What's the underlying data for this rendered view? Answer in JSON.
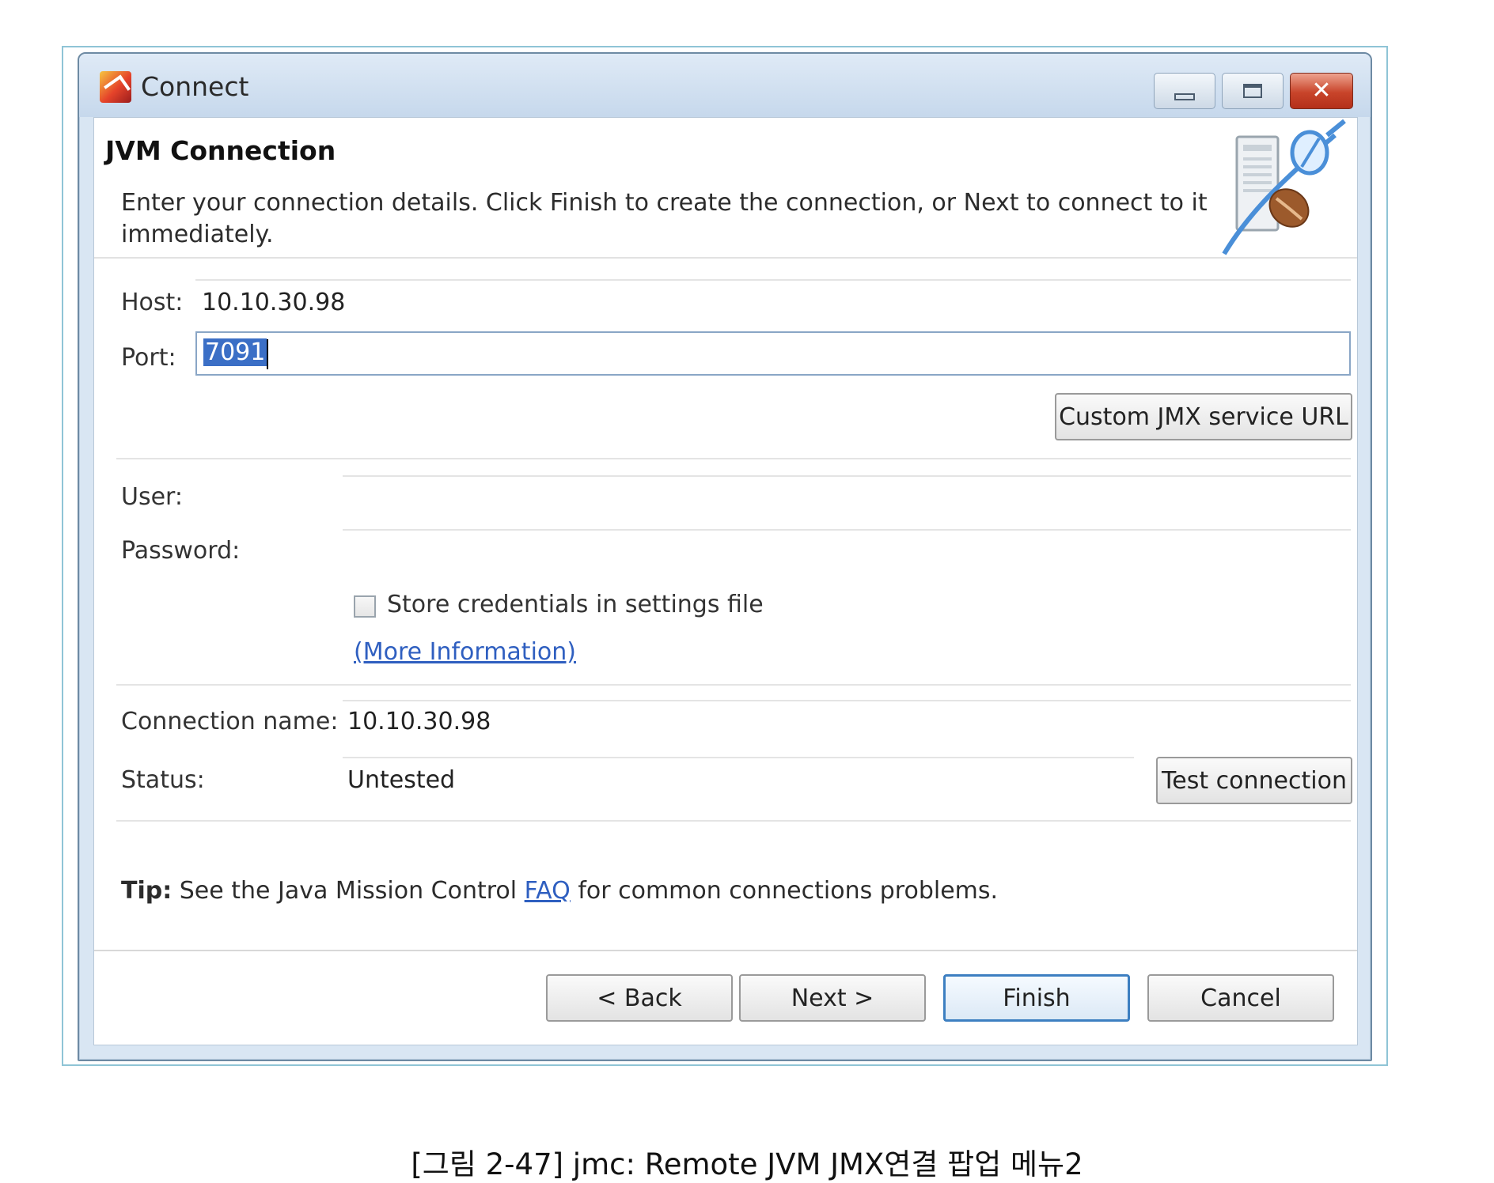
{
  "window": {
    "title": "Connect"
  },
  "header": {
    "title": "JVM Connection",
    "description": "Enter your connection details. Click Finish to create the connection, or Next to connect to it immediately."
  },
  "form": {
    "host_label": "Host:",
    "host_value": "10.10.30.98",
    "port_label": "Port:",
    "port_value": "7091",
    "custom_jmx_button": "Custom JMX service URL",
    "user_label": "User:",
    "user_value": "",
    "password_label": "Password:",
    "password_value": "",
    "store_credentials_label": "Store credentials in settings file",
    "store_credentials_checked": false,
    "more_info_link": "(More Information)",
    "connection_name_label": "Connection name:",
    "connection_name_value": "10.10.30.98",
    "status_label": "Status:",
    "status_value": "Untested",
    "test_connection_button": "Test connection"
  },
  "tip": {
    "prefix": "Tip:",
    "text_before": "See the Java Mission Control",
    "link": "FAQ",
    "text_after": "for common connections problems."
  },
  "footer": {
    "back_label": "< Back",
    "next_label": "Next >",
    "finish_label": "Finish",
    "cancel_label": "Cancel"
  },
  "caption": "[그림 2-47] jmc: Remote JVM JMX연결 팝업 메뉴2",
  "colors": {
    "close_button": "#c8442a",
    "selection": "#3b6fc6",
    "link": "#2f5fc0",
    "focus_border": "#3d7fc1"
  }
}
